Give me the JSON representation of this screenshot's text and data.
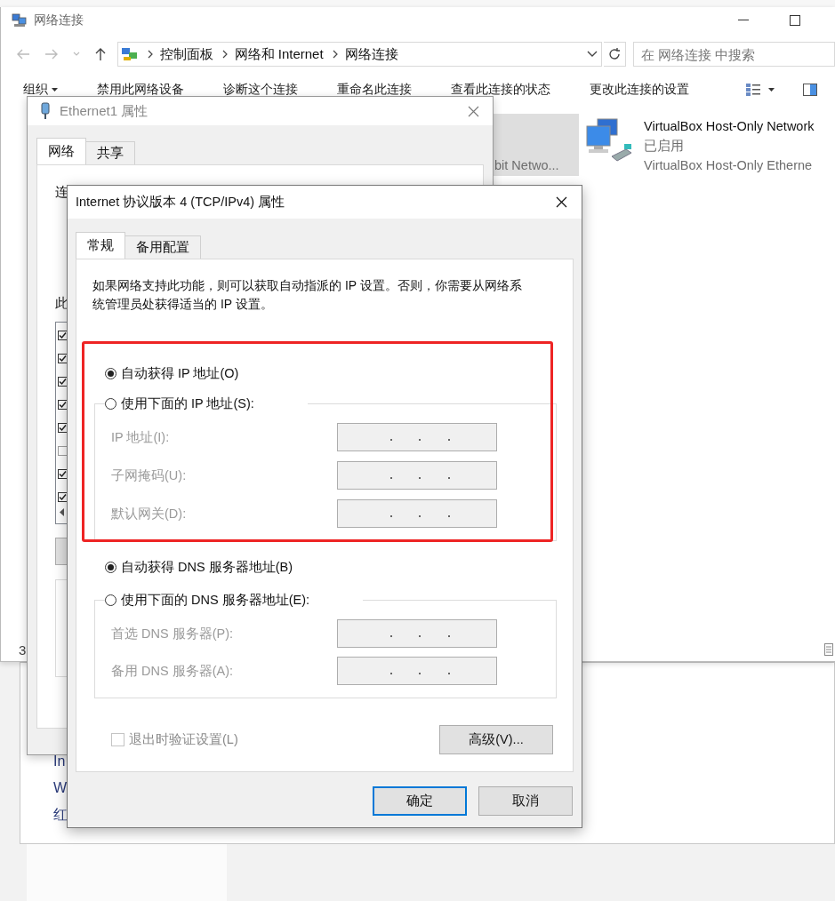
{
  "explorer": {
    "title": "网络连接",
    "breadcrumb": [
      "控制面板",
      "网络和 Internet",
      "网络连接"
    ],
    "search": {
      "placeholder": "在 网络连接 中搜索"
    },
    "toolbar": [
      {
        "label": "组织",
        "kind": "menu"
      },
      {
        "label": "禁用此网络设备",
        "kind": "command"
      },
      {
        "label": "诊断这个连接",
        "kind": "command"
      },
      {
        "label": "重命名此连接",
        "kind": "command"
      },
      {
        "label": "查看此连接的状态",
        "kind": "command"
      },
      {
        "label": "更改此连接的设置",
        "kind": "command"
      }
    ],
    "items": [
      {
        "device": "bit Netwo...",
        "selected": true
      },
      {
        "name": "VirtualBox Host-Only Network",
        "status": "已启用",
        "device": "VirtualBox Host-Only Etherne",
        "selected": false
      }
    ],
    "status_bar": "3"
  },
  "background_window": {
    "lines": [
      "In",
      "W",
      "红"
    ]
  },
  "ethernet_dialog": {
    "title": "Ethernet1 属性",
    "tabs": [
      {
        "label": "网络",
        "selected": true
      },
      {
        "label": "共享",
        "selected": false
      }
    ],
    "connect_label": "连",
    "components_label": "此",
    "components": [
      {
        "checked": true
      },
      {
        "checked": true
      },
      {
        "checked": true
      },
      {
        "checked": true
      },
      {
        "checked": true
      },
      {
        "checked": false
      },
      {
        "checked": true
      },
      {
        "checked": true
      }
    ]
  },
  "ipv4_dialog": {
    "title": "Internet 协议版本 4 (TCP/IPv4) 属性",
    "tabs": [
      {
        "label": "常规",
        "selected": true
      },
      {
        "label": "备用配置",
        "selected": false
      }
    ],
    "description": "如果网络支持此功能，则可以获取自动指派的 IP 设置。否则，你需要从网络系统管理员处获得适当的 IP 设置。",
    "ip_section_highlighted": true,
    "ip_mode": [
      {
        "label": "自动获得 IP 地址(O)",
        "selected": true
      },
      {
        "label": "使用下面的 IP 地址(S):",
        "selected": false
      }
    ],
    "ip_fields": [
      {
        "label": "IP 地址(I):",
        "disabled": true
      },
      {
        "label": "子网掩码(U):",
        "disabled": true
      },
      {
        "label": "默认网关(D):",
        "disabled": true
      }
    ],
    "dns_mode": [
      {
        "label": "自动获得 DNS 服务器地址(B)",
        "selected": true
      },
      {
        "label": "使用下面的 DNS 服务器地址(E):",
        "selected": false
      }
    ],
    "dns_fields": [
      {
        "label": "首选 DNS 服务器(P):",
        "disabled": true
      },
      {
        "label": "备用 DNS 服务器(A):",
        "disabled": true
      }
    ],
    "validate": {
      "label": "退出时验证设置(L)",
      "checked": false,
      "disabled": true
    },
    "advanced_button": "高级(V)...",
    "buttons": [
      {
        "label": "确定",
        "default": true
      },
      {
        "label": "取消",
        "default": false
      }
    ]
  }
}
